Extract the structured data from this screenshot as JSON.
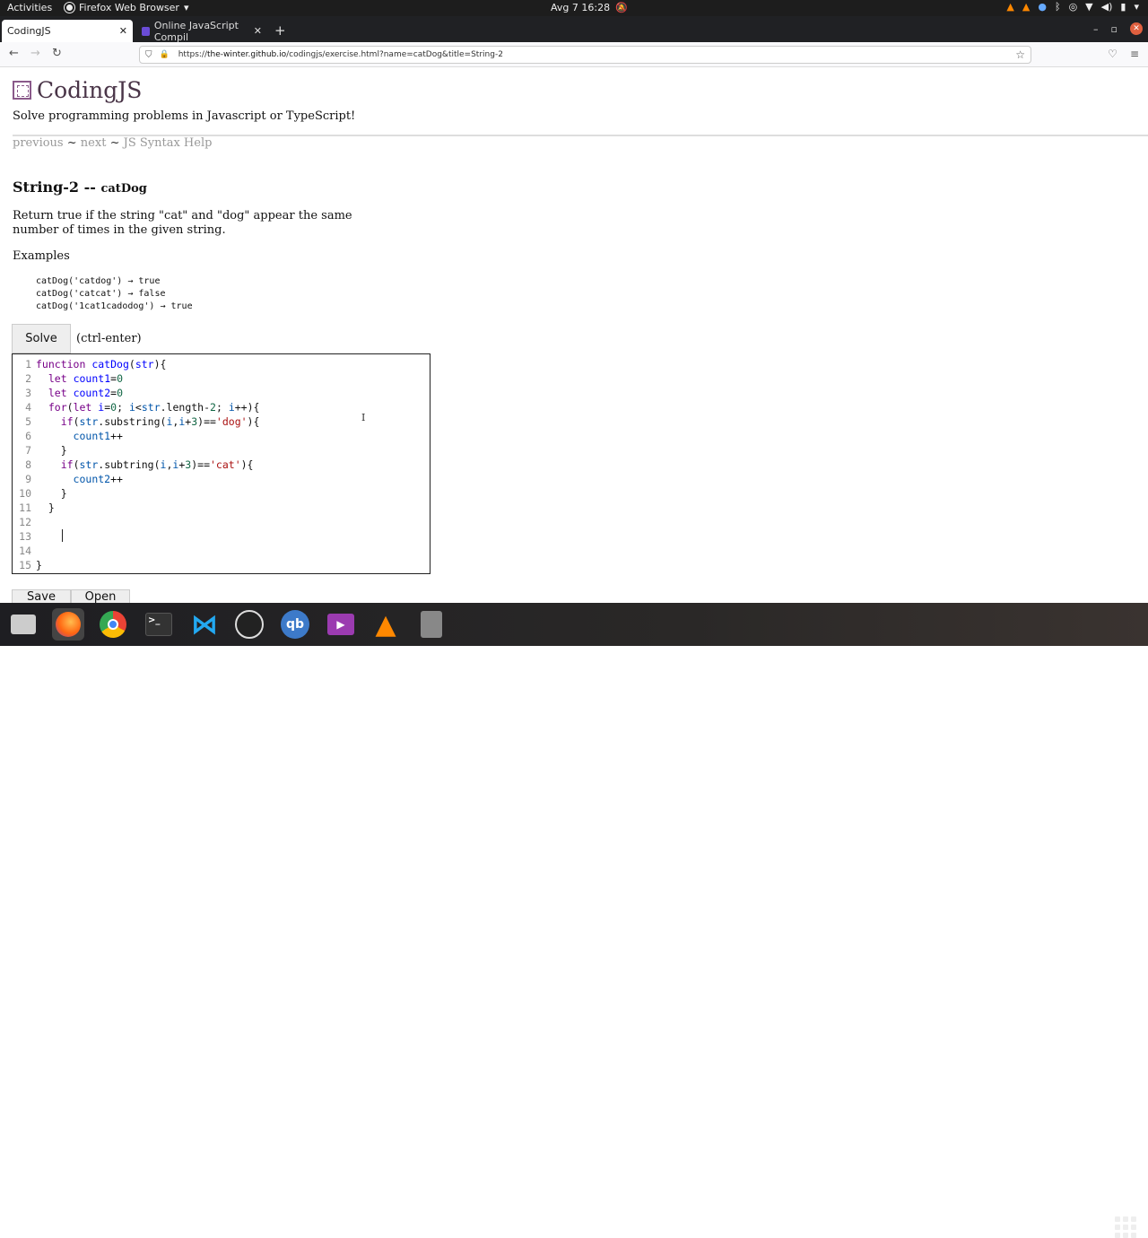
{
  "system_bar": {
    "activities": "Activities",
    "app_name": "Firefox Web Browser",
    "clock": "Avg 7  16:28"
  },
  "tabs": [
    {
      "label": "CodingJS",
      "active": true
    },
    {
      "label": "Online JavaScript Compil",
      "active": false
    }
  ],
  "address_bar": {
    "url_prefix": "https://",
    "url_host": "the-winter.github.io",
    "url_path": "/codingjs/exercise.html?name=catDog&title=String-2"
  },
  "page": {
    "logo_text": "CodingJS",
    "tagline": "Solve programming problems in Javascript or TypeScript!",
    "nav": {
      "previous": "previous",
      "sep": "~",
      "next": "next",
      "help": "JS Syntax Help"
    },
    "title": "String-2 -- ",
    "title_fn": "catDog",
    "description": "Return true if the string \"cat\" and \"dog\" appear the same number of times in the given string.",
    "examples_label": "Examples",
    "examples": [
      "catDog('catdog') → true",
      "catDog('catcat') → false",
      "catDog('1cat1cadodog') → true"
    ],
    "solve_label": "Solve",
    "solve_hint": "(ctrl-enter)",
    "save_label": "Save",
    "open_label": "Open"
  },
  "editor_lines": [
    "1",
    "2",
    "3",
    "4",
    "5",
    "6",
    "7",
    "8",
    "9",
    "10",
    "11",
    "12",
    "13",
    "14",
    "15"
  ],
  "dock_apps": [
    "files-icon",
    "firefox-icon",
    "chrome-icon",
    "terminal-icon",
    "vscode-icon",
    "obs-icon",
    "qbittorrent-icon",
    "video-icon",
    "vlc-icon",
    "drive-icon"
  ]
}
